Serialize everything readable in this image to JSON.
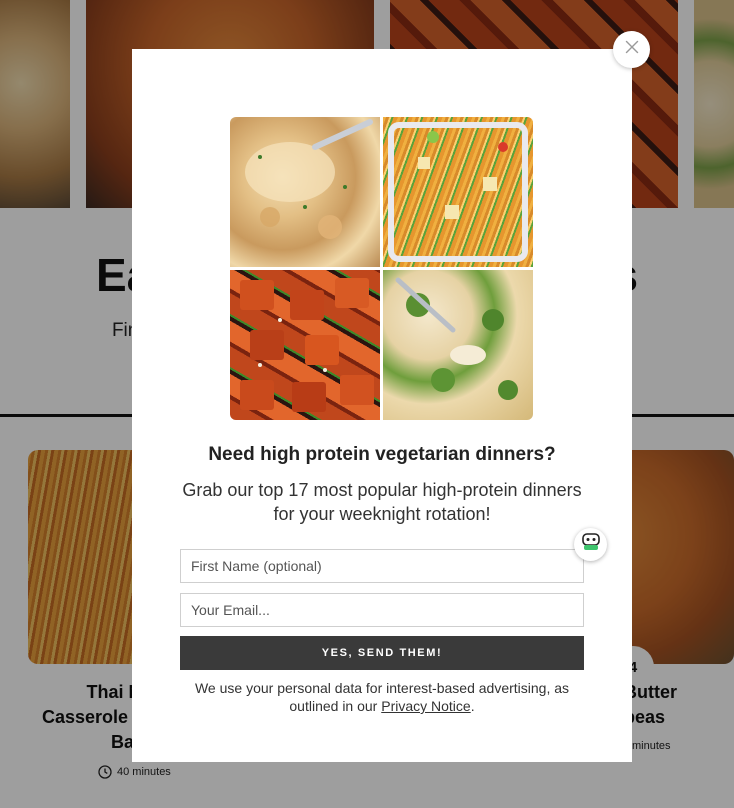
{
  "background": {
    "heading": "Easy Vegetarian Recipes",
    "subtext": "Find your favorite recipes, loved and rated by our community",
    "cards": [
      {
        "title_lines": [
          "Thai Noodle",
          "Casserole with Peanut",
          "Baked"
        ],
        "time": "40 minutes"
      },
      {
        "title_lines": [
          "Butter",
          "peas"
        ],
        "time": "minutes",
        "badge": "4"
      }
    ]
  },
  "modal": {
    "close_label": "×",
    "headline": "Need high protein vegetarian dinners?",
    "subline": "Grab our top 17 most popular high-protein dinners for your weeknight rotation!",
    "first_name_placeholder": "First Name (optional)",
    "email_placeholder": "Your Email...",
    "submit_label": "YES, SEND THEM!",
    "privacy_text_before": "We use your personal data for interest-based advertising, as outlined in our",
    "privacy_link": "Privacy Notice",
    "privacy_text_after": "."
  },
  "icons": {
    "close": "close-icon",
    "chat": "chat-bot-icon",
    "clock": "clock-icon"
  },
  "colors": {
    "button_bg": "#3a3a3a",
    "overlay": "rgba(0,0,0,0.38)",
    "chat_accent": "#3ec46d"
  }
}
